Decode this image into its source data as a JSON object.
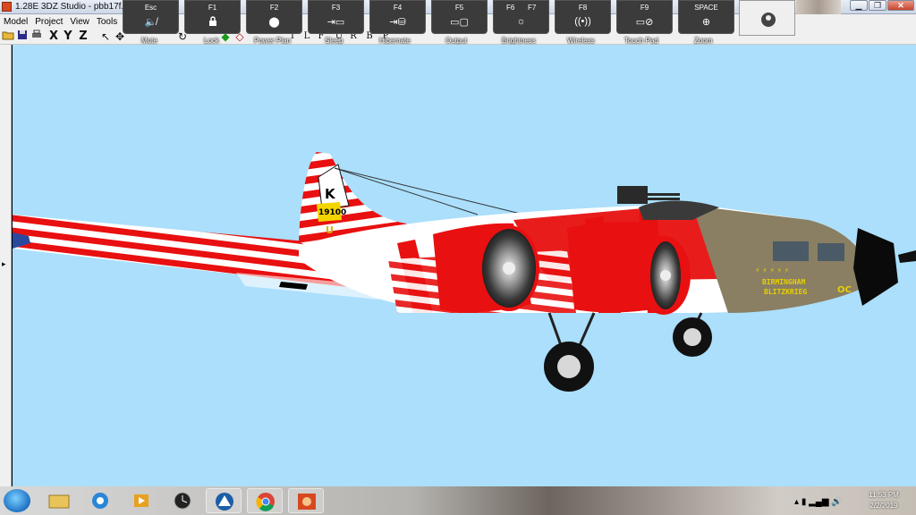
{
  "window": {
    "title": "1.28E 3DZ Studio - pbb17f.3d..."
  },
  "menu": {
    "items": [
      "Model",
      "Project",
      "View",
      "Tools"
    ]
  },
  "toolbar": {
    "axis_x": "X",
    "axis_y": "Y",
    "axis_z": "Z",
    "letters": [
      "T",
      "L",
      "F",
      "U",
      "R",
      "B",
      "P"
    ]
  },
  "function_keys": [
    {
      "key": "Esc",
      "label": "Mute",
      "icon": "speaker-mute-icon"
    },
    {
      "key": "F1",
      "label": "Lock",
      "icon": "lock-icon"
    },
    {
      "key": "F2",
      "label": "Power Plan",
      "icon": "power-plan-icon"
    },
    {
      "key": "F3",
      "label": "Sleep",
      "icon": "sleep-icon"
    },
    {
      "key": "F4",
      "label": "Hibernate",
      "icon": "hibernate-icon"
    },
    {
      "key": "F5",
      "label": "Output",
      "icon": "display-output-icon"
    },
    {
      "key": "F6",
      "key2": "F7",
      "label": "Brightness",
      "icon": "brightness-icon"
    },
    {
      "key": "F8",
      "label": "Wireless",
      "icon": "wireless-icon"
    },
    {
      "key": "F9",
      "label": "Touch Pad",
      "icon": "touchpad-icon"
    },
    {
      "key": "SPACE",
      "label": "Zoom",
      "icon": "zoom-icon"
    }
  ],
  "aircraft_markings": {
    "tail_letter": "K",
    "tail_number": "19100",
    "tail_sub": "U",
    "nose_name_line1": "BIRMINGHAM",
    "nose_name_line2": "BLITZKRIEG",
    "nose_code": "OC"
  },
  "colors": {
    "viewport_bg": "#abdffb",
    "stripe_red": "#e81010",
    "stripe_white": "#ffffff",
    "nose_olive": "#8a7f63"
  },
  "taskbar": {
    "apps": [
      "start-orb",
      "file-explorer",
      "internet-explorer",
      "media-player",
      "clock-app",
      "app-blue",
      "chrome",
      "3dz-studio"
    ]
  },
  "clock": {
    "time": "11:53 PM",
    "date": "2/2/2019"
  }
}
